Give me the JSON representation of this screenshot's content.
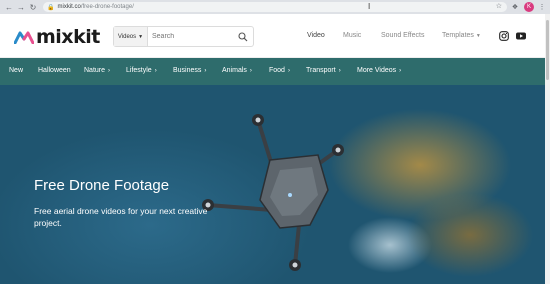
{
  "browser": {
    "url_host": "mixkit.co",
    "url_path": "/free-drone-footage/",
    "profile_initial": "K"
  },
  "header": {
    "logo_text": "mixkit",
    "search": {
      "category": "Videos",
      "placeholder": "Search"
    },
    "nav": {
      "video": "Video",
      "music": "Music",
      "sound_effects": "Sound Effects",
      "templates": "Templates"
    }
  },
  "categories": {
    "new": "New",
    "halloween": "Halloween",
    "nature": "Nature",
    "lifestyle": "Lifestyle",
    "business": "Business",
    "animals": "Animals",
    "food": "Food",
    "transport": "Transport",
    "more_videos": "More Videos"
  },
  "hero": {
    "title": "Free Drone Footage",
    "subtitle": "Free aerial drone videos for your next creative project."
  },
  "colors": {
    "category_bar": "#2e6c6c",
    "logo_accent": "#e8508f",
    "logo_blue": "#2a8bc9"
  }
}
